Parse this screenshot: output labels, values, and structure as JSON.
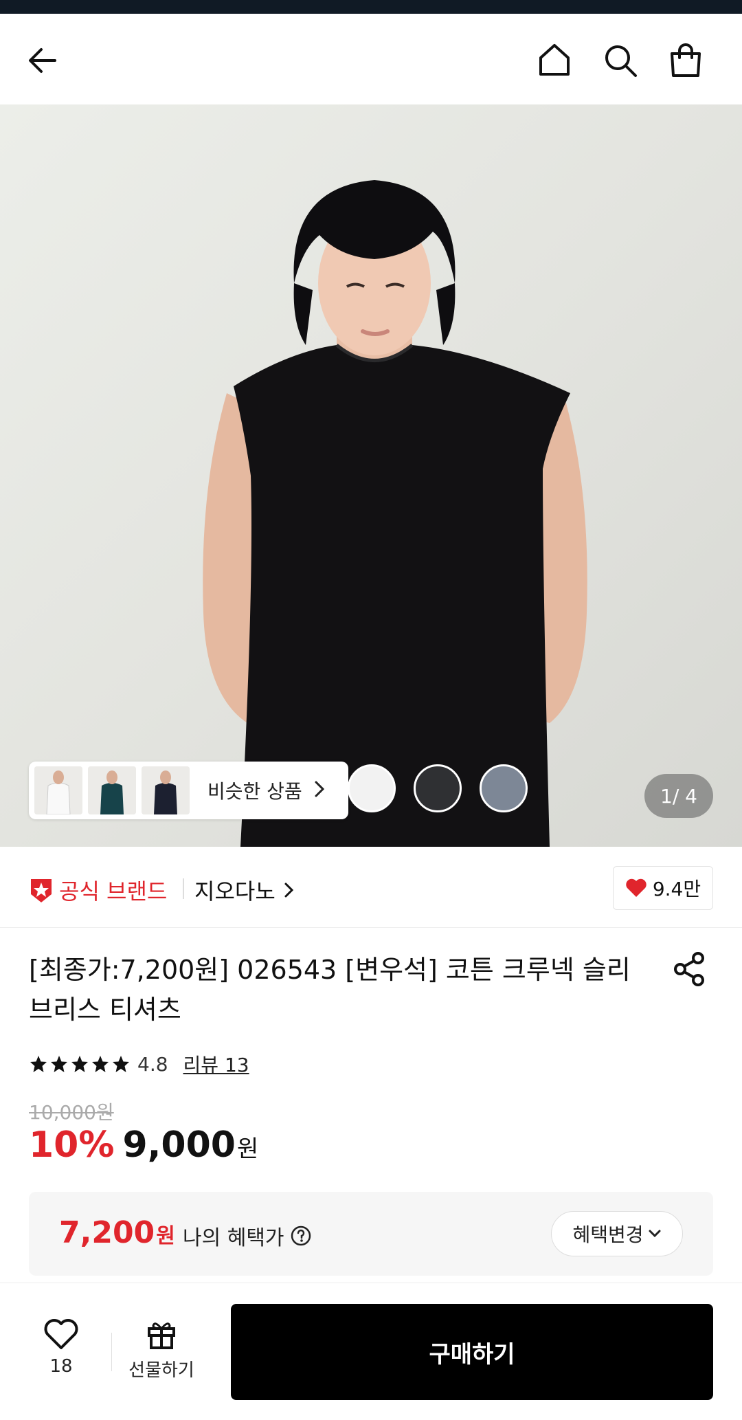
{
  "colors": {
    "accent_red": "#e0252c",
    "buy_button": "#000000",
    "status_strip": "#101a25"
  },
  "header": {
    "icons": [
      "back-arrow-icon",
      "home-icon",
      "search-icon",
      "shopping-bag-icon"
    ]
  },
  "gallery": {
    "similar_label": "비슷한 상품",
    "swatch_colors": [
      "#f2f2f2",
      "#2f3033",
      "#7d8796"
    ],
    "counter": "1/ 4"
  },
  "brand": {
    "official_label": "공식 브랜드",
    "brand_name": "지오다노",
    "likes": "9.4만"
  },
  "product": {
    "title": "[최종가:7,200원] 026543 [변우석] 코튼 크루넥 슬리브리스 티셔츠",
    "rating": "4.8",
    "stars": 5,
    "review_label": "리뷰 13",
    "original_price": "10,000원",
    "discount": "10%",
    "price": "9,000",
    "price_unit": "원"
  },
  "benefit": {
    "price": "7,200",
    "price_unit": "원",
    "label": "나의 혜택가",
    "change_label": "혜택변경"
  },
  "bottom": {
    "wish_count": "18",
    "gift_label": "선물하기",
    "buy_label": "구매하기"
  }
}
